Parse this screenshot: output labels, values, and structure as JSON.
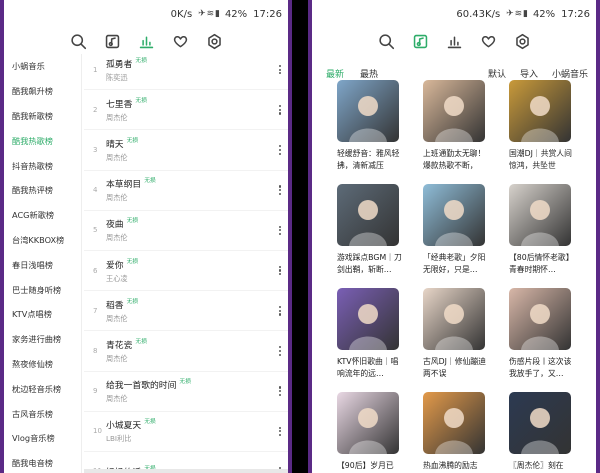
{
  "left": {
    "status": {
      "speed": "0K/s",
      "battery": "42%",
      "time": "17:26"
    },
    "sidebar": [
      {
        "label": "小蜗音乐",
        "active": false
      },
      {
        "label": "酷我飙升榜",
        "active": false
      },
      {
        "label": "酷我新歌榜",
        "active": false
      },
      {
        "label": "酷我热歌榜",
        "active": true
      },
      {
        "label": "抖音热歌榜",
        "active": false
      },
      {
        "label": "酷我热评榜",
        "active": false
      },
      {
        "label": "ACG新歌榜",
        "active": false
      },
      {
        "label": "台湾KKBOX榜",
        "active": false
      },
      {
        "label": "春日浅唱榜",
        "active": false
      },
      {
        "label": "巴士随身听榜",
        "active": false
      },
      {
        "label": "KTV点唱榜",
        "active": false
      },
      {
        "label": "家务进行曲榜",
        "active": false
      },
      {
        "label": "熬夜修仙榜",
        "active": false
      },
      {
        "label": "枕边轻音乐榜",
        "active": false
      },
      {
        "label": "古风音乐榜",
        "active": false
      },
      {
        "label": "Vlog音乐榜",
        "active": false
      },
      {
        "label": "酷我电音榜",
        "active": false
      }
    ],
    "songs": [
      {
        "idx": "1",
        "title": "孤勇者",
        "badge": "无损",
        "artist": "陈奕迅"
      },
      {
        "idx": "2",
        "title": "七里香",
        "badge": "无损",
        "artist": "周杰伦"
      },
      {
        "idx": "3",
        "title": "晴天",
        "badge": "无损",
        "artist": "周杰伦"
      },
      {
        "idx": "4",
        "title": "本草纲目",
        "badge": "无损",
        "artist": "周杰伦"
      },
      {
        "idx": "5",
        "title": "夜曲",
        "badge": "无损",
        "artist": "周杰伦"
      },
      {
        "idx": "6",
        "title": "爱你",
        "badge": "无损",
        "artist": "王心凌"
      },
      {
        "idx": "7",
        "title": "稻香",
        "badge": "无损",
        "artist": "周杰伦"
      },
      {
        "idx": "8",
        "title": "青花瓷",
        "badge": "无损",
        "artist": "周杰伦"
      },
      {
        "idx": "9",
        "title": "给我一首歌的时间",
        "badge": "无损",
        "artist": "周杰伦"
      },
      {
        "idx": "10",
        "title": "小城夏天",
        "badge": "无损",
        "artist": "LBI利比"
      },
      {
        "idx": "11",
        "title": "妈妈的话",
        "badge": "无损",
        "artist": ""
      }
    ]
  },
  "right": {
    "status": {
      "speed": "60.43K/s",
      "battery": "42%",
      "time": "17:26"
    },
    "tabs": [
      {
        "label": "最新",
        "active": true
      },
      {
        "label": "最热",
        "active": false
      }
    ],
    "actions": [
      "默认",
      "导入",
      "小蜗音乐"
    ],
    "playlists": [
      {
        "caption": "轻缓舒音：雅风轻拂，清新减压",
        "hue": "#7fa6c9"
      },
      {
        "caption": "上班通勤太无聊！爆款热歌不断，",
        "hue": "#d9b89a"
      },
      {
        "caption": "国潮DJ｜共赏人间惊鸿，共坠世",
        "hue": "#c99a3a"
      },
      {
        "caption": "游戏踩点BGM｜刀剑出鞘，斩断…",
        "hue": "#5d6b78"
      },
      {
        "caption": "「经典老歌」夕阳无限好，只是…",
        "hue": "#8fbdd8"
      },
      {
        "caption": "【80后情怀老歌】青春时期怀…",
        "hue": "#d7d2cc"
      },
      {
        "caption": "KTV怀旧歌曲｜唱响流年的远…",
        "hue": "#7a5fb5"
      },
      {
        "caption": "古风DJ｜修仙蹦迪两不误",
        "hue": "#e8d6c8"
      },
      {
        "caption": "伤感片段丨这次该我放手了，又…",
        "hue": "#d8b7a8"
      },
      {
        "caption": "【90后】岁月已",
        "hue": "#e9d8e4"
      },
      {
        "caption": "热血沸腾的励志",
        "hue": "#e39a4a"
      },
      {
        "caption": "〖周杰伦〗刻在",
        "hue": "#2c3a52"
      }
    ]
  }
}
